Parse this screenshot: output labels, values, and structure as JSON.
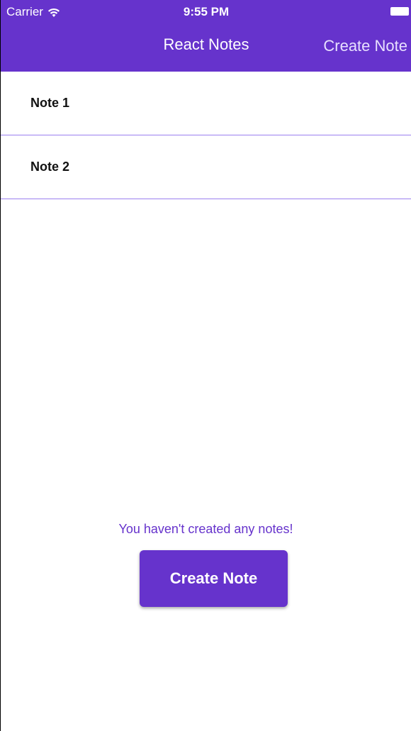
{
  "colors": {
    "primary": "#6633cc",
    "divider": "#9b7ff0",
    "background": "#ffffff"
  },
  "status_bar": {
    "carrier": "Carrier",
    "time": "9:55 PM",
    "wifi_icon": "wifi-icon",
    "battery_icon": "battery-icon"
  },
  "nav_bar": {
    "title": "React Notes",
    "action_label": "Create Note"
  },
  "notes": [
    {
      "title": "Note 1"
    },
    {
      "title": "Note 2"
    }
  ],
  "empty_state": {
    "message": "You haven't created any notes!",
    "button_label": "Create Note"
  }
}
